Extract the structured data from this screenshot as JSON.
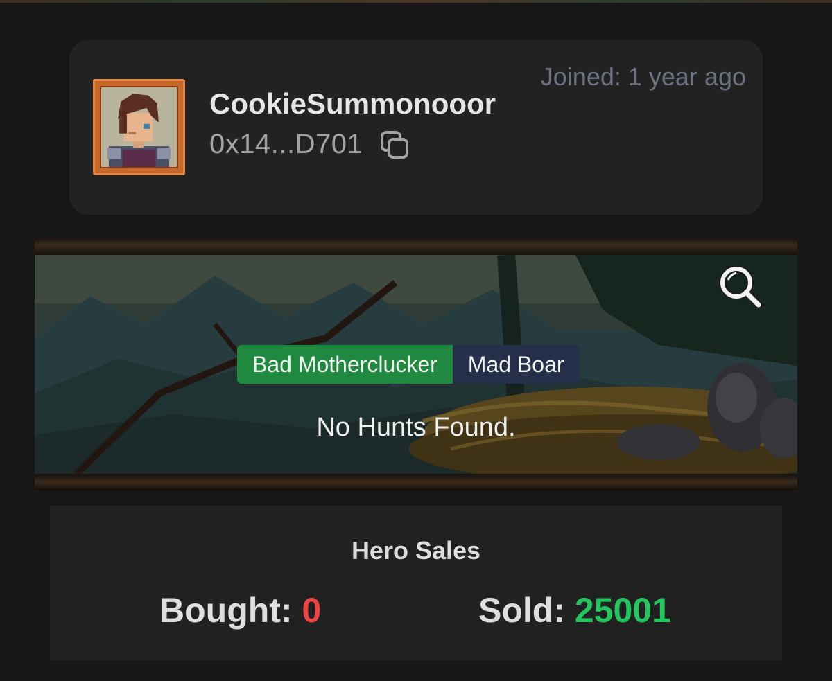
{
  "profile": {
    "username": "CookieSummonooor",
    "address": "0x14...D701",
    "joined": "Joined: 1 year ago"
  },
  "hunts": {
    "tabs": [
      {
        "label": "Bad Motherclucker",
        "active": true
      },
      {
        "label": "Mad Boar",
        "active": false
      }
    ],
    "empty_message": "No Hunts Found."
  },
  "sales": {
    "title": "Hero Sales",
    "bought_label": "Bought:",
    "bought_value": "0",
    "sold_label": "Sold:",
    "sold_value": "25001"
  },
  "colors": {
    "accent_green": "#1f8a3f",
    "sold_green": "#22c55e",
    "bought_red": "#ef4444",
    "tab_inactive": "#26304a"
  },
  "icons": {
    "copy": "copy-icon",
    "search": "search-icon"
  }
}
